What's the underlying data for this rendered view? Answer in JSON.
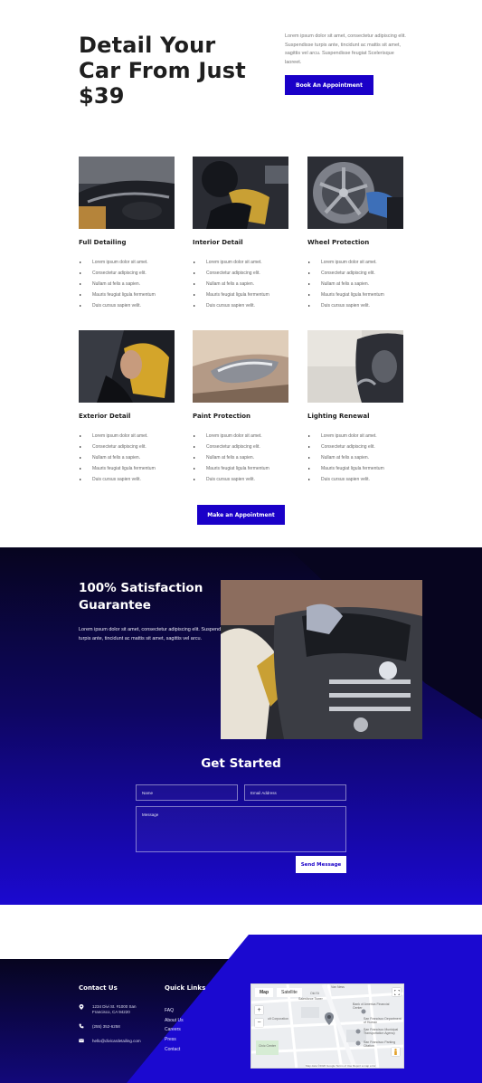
{
  "hero": {
    "title_line1": "Detail Your",
    "title_line2": "Car From Just",
    "title_line3": "$39",
    "text": "Lorem ipsum dolor sit amet, consectetur adipiscing elit. Suspendisse turpis ante, tincidunt ac mattis sit amet, sagittis vel arcu. Suspendisse feugiat Scelerisque laoreet.",
    "button_label": "Book An Appointment"
  },
  "services": [
    {
      "title": "Full Detailing",
      "items": [
        "Lorem ipsum dolor sit amet.",
        "Consectetur adipiscing elit.",
        "Nullam at felis a sapien.",
        "Mauris feugiat ligula fermentum",
        "Duis cursus sapien velit."
      ]
    },
    {
      "title": "Interior Detail",
      "items": [
        "Lorem ipsum dolor sit amet.",
        "Consectetur adipiscing elit.",
        "Nullam at felis a sapien.",
        "Mauris feugiat ligula fermentum",
        "Duis cursus sapien velit."
      ]
    },
    {
      "title": "Wheel Protection",
      "items": [
        "Lorem ipsum dolor sit amet.",
        "Consectetur adipiscing elit.",
        "Nullam at felis a sapien.",
        "Mauris feugiat ligula fermentum",
        "Duis cursus sapien velit."
      ]
    },
    {
      "title": "Exterior Detail",
      "items": [
        "Lorem ipsum dolor sit amet.",
        "Consectetur adipiscing elit.",
        "Nullam at felis a sapien.",
        "Mauris feugiat ligula fermentum",
        "Duis cursus sapien velit."
      ]
    },
    {
      "title": "Paint Protection",
      "items": [
        "Lorem ipsum dolor sit amet.",
        "Consectetur adipiscing elit.",
        "Nullam at felis a sapien.",
        "Mauris feugiat ligula fermentum",
        "Duis cursus sapien velit."
      ]
    },
    {
      "title": "Lighting Renewal",
      "items": [
        "Lorem ipsum dolor sit amet.",
        "Consectetur adipiscing elit.",
        "Nullam at felis a sapien.",
        "Mauris feugiat ligula fermentum",
        "Duis cursus sapien velit."
      ]
    }
  ],
  "make_appointment_label": "Make an Appointment",
  "guarantee": {
    "title_line1": "100% Satisfaction",
    "title_line2": "Guarantee",
    "text": "Lorem ipsum dolor sit amet, consectetur adipiscing elit. Suspendisse turpis ante, tincidunt ac mattis sit amet, sagittis vel arcu."
  },
  "get_started": {
    "title": "Get Started",
    "name_placeholder": "Name",
    "email_placeholder": "Email Address",
    "message_placeholder": "Message",
    "send_label": "Send Message"
  },
  "footer": {
    "contact_heading": "Contact Us",
    "address_line1": "1234 Divi St. #1000 San",
    "address_line2": "Francisco, CA 94220",
    "phone": "(255) 352-6258",
    "email": "hello@divicardetailing.com",
    "links_heading": "Quick Links",
    "links": [
      "FAQ",
      "About Us",
      "Careers",
      "Press",
      "Contact"
    ]
  },
  "map": {
    "tab_map": "Map",
    "tab_satellite": "Satellite",
    "zoom_in": "+",
    "zoom_out": "−",
    "labels": [
      "Van Ness",
      "Old St",
      "Bank of America Financial Center",
      "Salesforce Tower",
      "San Francisco Department of Human",
      "San Francisco Municipal Transportation Agency",
      "San Francisco Parking Citation",
      "ult Corporation",
      "Civic Center"
    ],
    "attribution": "Map data ©2020 Google   Terms of Use   Report a map error"
  },
  "colors": {
    "accent": "#1a00c8",
    "dark_navy": "#07051f",
    "text_dark": "#1f1f1f"
  }
}
